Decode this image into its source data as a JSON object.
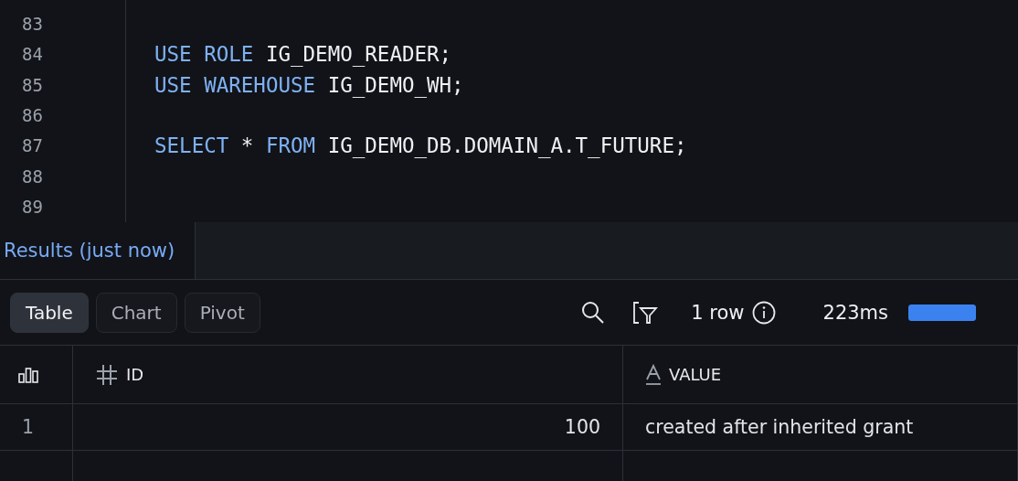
{
  "editor": {
    "lines": [
      {
        "number": "83"
      },
      {
        "number": "84",
        "tokens": [
          {
            "text": "USE ROLE",
            "kind": "keyword"
          },
          {
            "text": " IG_DEMO_READER;",
            "kind": "plain"
          }
        ]
      },
      {
        "number": "85",
        "tokens": [
          {
            "text": "USE WAREHOUSE",
            "kind": "keyword"
          },
          {
            "text": " IG_DEMO_WH;",
            "kind": "plain"
          }
        ]
      },
      {
        "number": "86"
      },
      {
        "number": "87",
        "tokens": [
          {
            "text": "SELECT",
            "kind": "keyword"
          },
          {
            "text": " * ",
            "kind": "plain"
          },
          {
            "text": "FROM",
            "kind": "keyword"
          },
          {
            "text": " IG_DEMO_DB.DOMAIN_A.T_FUTURE;",
            "kind": "plain"
          }
        ]
      },
      {
        "number": "88"
      },
      {
        "number": "89"
      }
    ]
  },
  "results_tab": {
    "label": "Results (just now)"
  },
  "views": [
    {
      "label": "Table",
      "selected": true
    },
    {
      "label": "Chart",
      "selected": false
    },
    {
      "label": "Pivot",
      "selected": false
    }
  ],
  "summary": {
    "row_count": "1 row",
    "duration": "223ms",
    "level": 1
  },
  "table": {
    "columns": [
      {
        "kind": "rownum"
      },
      {
        "kind": "number",
        "label": "ID"
      },
      {
        "kind": "text",
        "label": "VALUE"
      }
    ],
    "rows": [
      {
        "cells": [
          "1",
          "100",
          "created after inherited grant"
        ]
      }
    ]
  }
}
